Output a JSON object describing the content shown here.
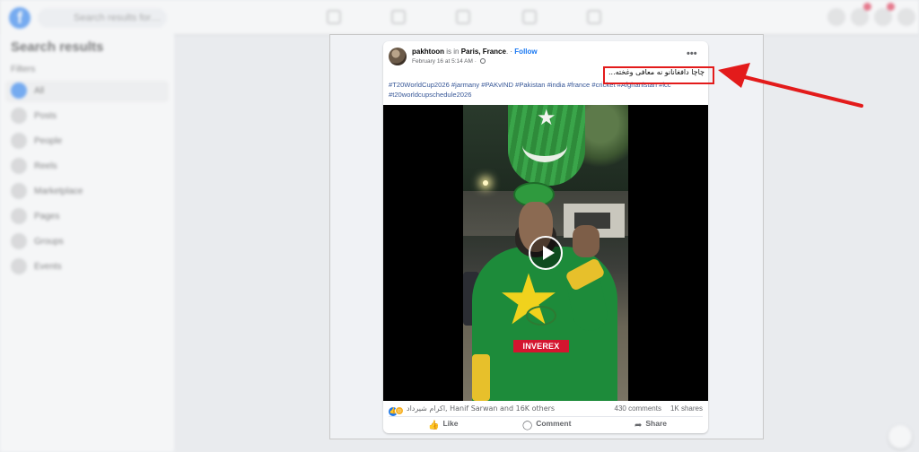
{
  "shell": {
    "search_placeholder": "Search results for…",
    "sidebar_title": "Search results",
    "filters_label": "Filters",
    "sidebar_items": [
      "All",
      "Posts",
      "People",
      "Reels",
      "Marketplace",
      "Pages",
      "Groups",
      "Events"
    ]
  },
  "post": {
    "author": "pakhtoon",
    "is_in": "is in",
    "location": "Paris, France",
    "follow_label": "Follow",
    "timestamp": "February 16 at 5:14 AM",
    "more_label": "•••",
    "caption": "چاچا دافغانانو نه معافی وغخته...",
    "hashtags": "#T20WorldCup2026 #jarmany #PAKvIND #Pakistan #india #france #cricket #Afghanistan #icc #t20worldcupschedule2026",
    "video": {
      "jersey_text": "INVEREX"
    },
    "reactions_text": "اکرام شیرداد, Hanif Sarwan and 16K others",
    "comments_count": "430 comments",
    "shares_count": "1K shares",
    "actions": {
      "like": "Like",
      "comment": "Comment",
      "share": "Share"
    }
  },
  "annotation": {
    "highlight_color": "#e31b1b"
  },
  "colors": {
    "facebook_blue": "#1877f2",
    "link_blue": "#385898"
  }
}
